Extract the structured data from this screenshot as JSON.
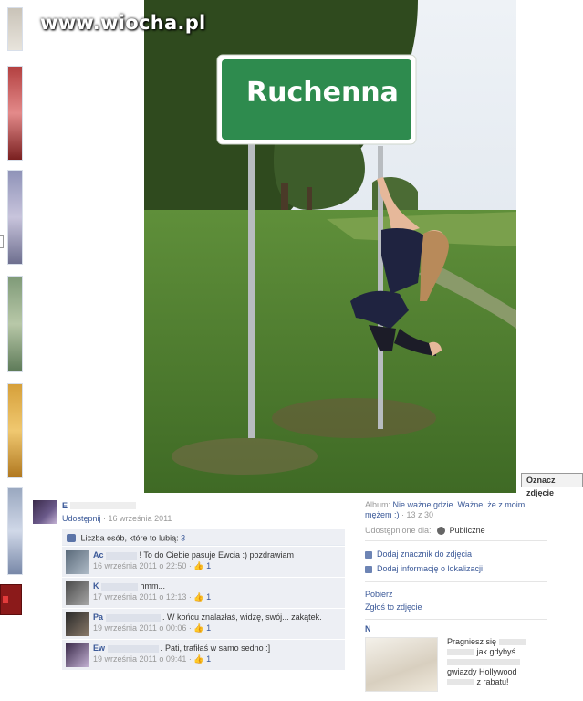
{
  "watermark": "www.wiocha.pl",
  "photo": {
    "sign_text": "Ruchenna",
    "tag_button": "Oznacz zdjęcie"
  },
  "post": {
    "author_initial": "E",
    "share_link": "Udostępnij",
    "date": "· 16 września 2011"
  },
  "likes": {
    "label": "Liczba osób, które to lubią: ",
    "count": "3"
  },
  "comments": [
    {
      "name": "Ac",
      "text": "! To do Ciebie pasuje Ewcia :) pozdrawiam",
      "date": "16 września 2011 o 22:50",
      "likes": "1"
    },
    {
      "name": "K",
      "text": "hmm...",
      "date": "17 września 2011 o 12:13",
      "likes": "1"
    },
    {
      "name": "Pa",
      "text": ". W końcu znalazłaś, widzę, swój... zakątek.",
      "date": "19 września 2011 o 00:06",
      "likes": "1"
    },
    {
      "name": "Ew",
      "text": ". Pati, trafiłaś w samo sedno :]",
      "date": "19 września 2011 o 09:41",
      "likes": "1"
    }
  ],
  "sidebar": {
    "album_label": "Album: ",
    "album_name": "Nie ważne gdzie. Ważne, że z moim mężem :)",
    "album_count": "· 13 z 30",
    "shared_label": "Udostępnione dla:",
    "shared_value": "Publiczne",
    "add_tag": "Dodaj znacznik do zdjęcia",
    "add_location": "Dodaj informację o lokalizacji",
    "download": "Pobierz",
    "report": "Zgłoś to zdjęcie"
  },
  "ad": {
    "title": "N",
    "text_1": "Pragniesz się",
    "text_2": "jak gdybyś",
    "text_3": "gwiazdy Hollywood",
    "text_4": "z rabatu!"
  },
  "colors": {
    "link": "#3b5998",
    "sign_green": "#2e8b4e",
    "comment_bg": "#edeff4"
  }
}
